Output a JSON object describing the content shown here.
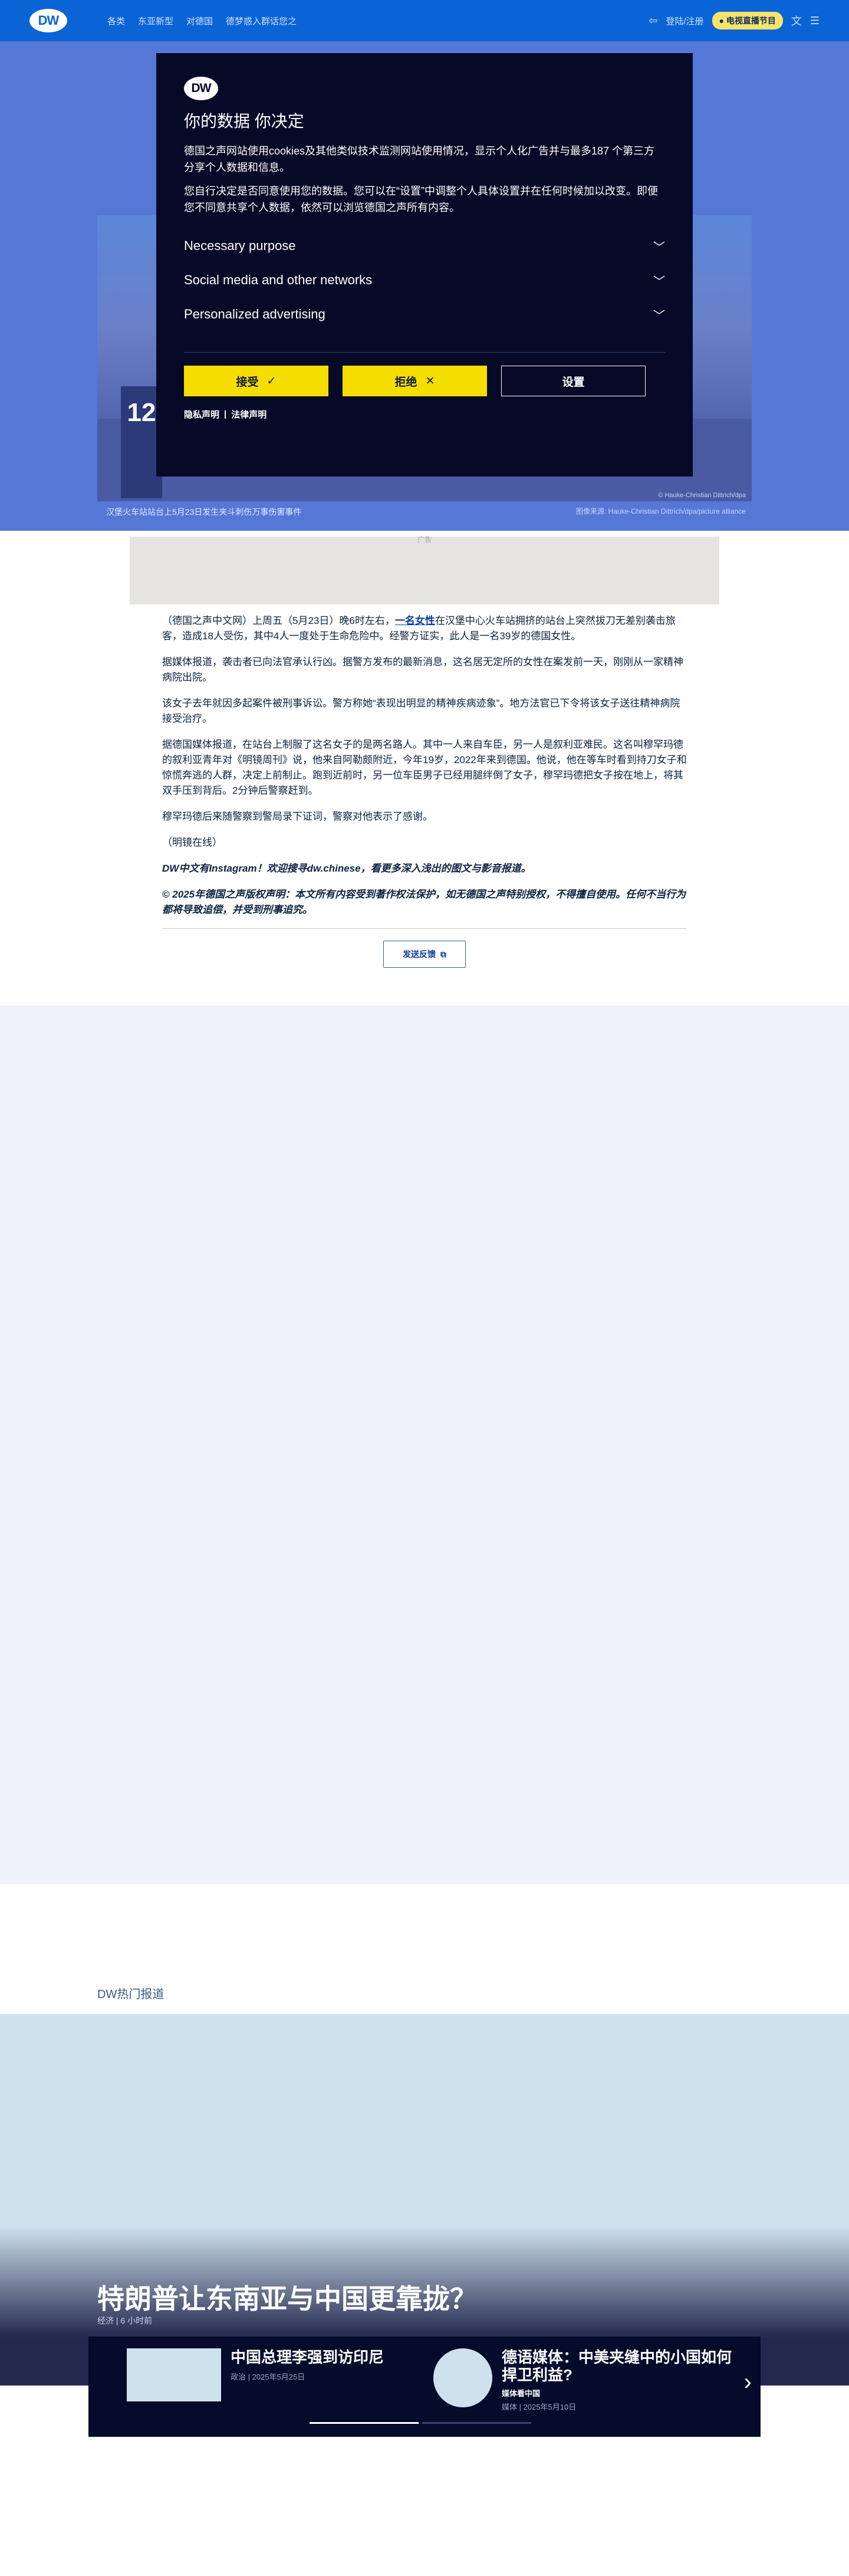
{
  "nav": {
    "logo": "DW",
    "links": [
      "各类",
      "东亚新型",
      "对德国",
      "德梦惑入群话您之"
    ],
    "signin": "登陆/注册",
    "live": "电视直播节目"
  },
  "hero": {
    "platform_number": "12",
    "photo_credit": "© Hauke-Christian Dittrich/dpa",
    "caption": "汉堡火车站站台上5月23日发生夹斗刺伤万事伤害事件",
    "caption_credit": "图像来源: Hauke-Christian Dittrich/dpa/picture alliance"
  },
  "ad": {
    "label": "广告"
  },
  "article": {
    "p1_before": "（德国之声中文网）上周五（5月23日）晚6时左右，",
    "p1_link": "一名女性",
    "p1_after": "在汉堡中心火车站拥挤的站台上突然拔刀无差别袭击旅客，造成18人受伤，其中4人一度处于生命危险中。经警方证实，此人是一名39岁的德国女性。",
    "p2": "据媒体报道，袭击者已向法官承认行凶。据警方发布的最新消息，这名居无定所的女性在案发前一天，刚刚从一家精神病院出院。",
    "p3": "该女子去年就因多起案件被刑事诉讼。警方称她“表现出明显的精神疾病迹象”。地方法官已下令将该女子送往精神病院接受治疗。",
    "p4": "据德国媒体报道，在站台上制服了这名女子的是两名路人。其中一人来自车臣，另一人是叙利亚难民。这名叫穆罕玛德的叙利亚青年对《明镜周刊》说，他来自阿勒颇附近，今年19岁，2022年来到德国。他说，他在等车时看到持刀女子和惊慌奔逃的人群，决定上前制止。跑到近前时，另一位车臣男子已经用腿绊倒了女子，穆罕玛德把女子按在地上，将其双手压到背后。2分钟后警察赶到。",
    "p5": "穆罕玛德后来随警察到警局录下证词，警察对他表示了感谢。",
    "source": "（明镜在线）",
    "promo": "DW中文有Instagram！欢迎搜寻dw.chinese，看更多深入浅出的图文与影音报道。",
    "copyright": "© 2025年德国之声版权声明：本文所有内容受到著作权法保护，如无德国之声特别授权，不得擅自使用。任何不当行为都将导致追偿，并受到刑事追究。",
    "feedback": "发送反馈"
  },
  "popular": {
    "label": "DW热门报道",
    "title": "特朗普让东南亚与中国更靠拢？",
    "meta": "经济 | 6 小时前",
    "cards": [
      {
        "title": "中国总理李强到访印尼",
        "meta": "政治 | 2025年5月25日"
      },
      {
        "title": "德语媒体：中美夹缝中的小国如何捍卫利益?",
        "tag": "媒体看中国",
        "meta": "媒体 | 2025年5月10日"
      }
    ]
  },
  "consent": {
    "logo": "DW",
    "title": "你的数据 你决定",
    "intro": "德国之声网站使用cookies及其他类似技术监测网站使用情况，显示个人化广告并与最多187 个第三方分享个人数据和信息。",
    "intro2": "您自行决定是否同意使用您的数据。您可以在“设置”中调整个人具体设置并在任何时候加以改变。即便您不同意共享个人数据，依然可以浏览德国之声所有内容。",
    "purposes": [
      "Necessary purpose",
      "Social media and other networks",
      "Personalized advertising"
    ],
    "accept": "接受",
    "reject": "拒绝",
    "settings": "设置",
    "privacy": "隐私声明",
    "separator": "|",
    "legal": "法律声明"
  }
}
